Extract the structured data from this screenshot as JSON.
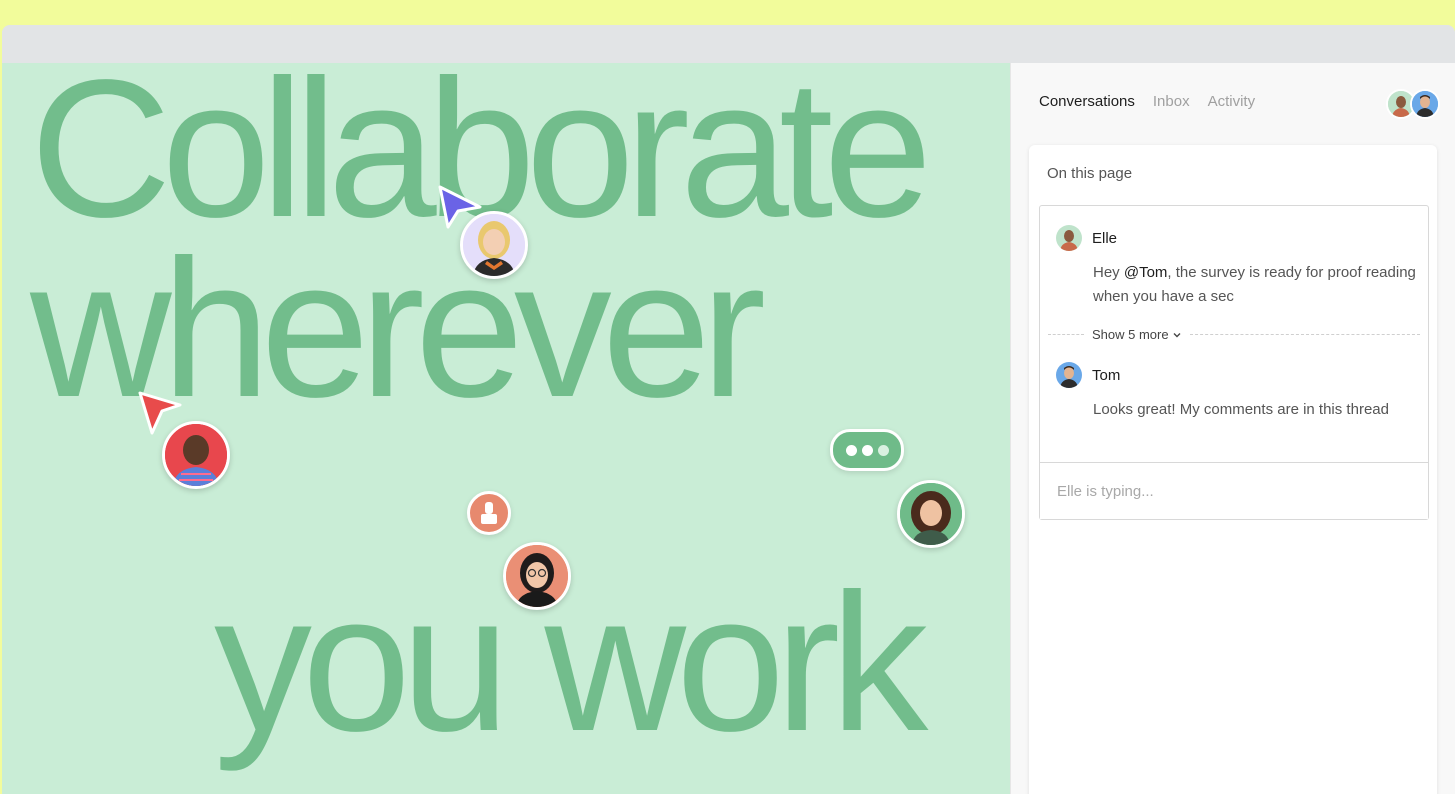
{
  "headline": {
    "line1": "Collaborate",
    "line2": "wherever",
    "line3": "you work"
  },
  "canvas_people": [
    {
      "name": "avatar-blonde-woman",
      "cursor_color": "#6a63e6"
    },
    {
      "name": "avatar-man-striped-shirt",
      "cursor_color": "#e84b4b"
    },
    {
      "name": "avatar-woman-glasses"
    },
    {
      "name": "avatar-curly-hair-woman"
    }
  ],
  "colors": {
    "background": "#f2fc9b",
    "canvas": "#c9edd6",
    "headline": "#72bd8c",
    "typing_bubble": "#6fbb89",
    "stamp": "#e7896e"
  },
  "panel": {
    "tabs": [
      {
        "label": "Conversations",
        "active": true
      },
      {
        "label": "Inbox",
        "active": false
      },
      {
        "label": "Activity",
        "active": false
      }
    ],
    "card_title": "On this page",
    "thread": {
      "messages": [
        {
          "author": "Elle",
          "text_before": "Hey ",
          "mention": "@Tom",
          "text_after": ", the survey is ready for proof reading when you have a sec"
        },
        {
          "author": "Tom",
          "text": "Looks great! My comments are in this thread"
        }
      ],
      "show_more": "Show 5 more",
      "typing_status": "Elle is typing..."
    }
  }
}
